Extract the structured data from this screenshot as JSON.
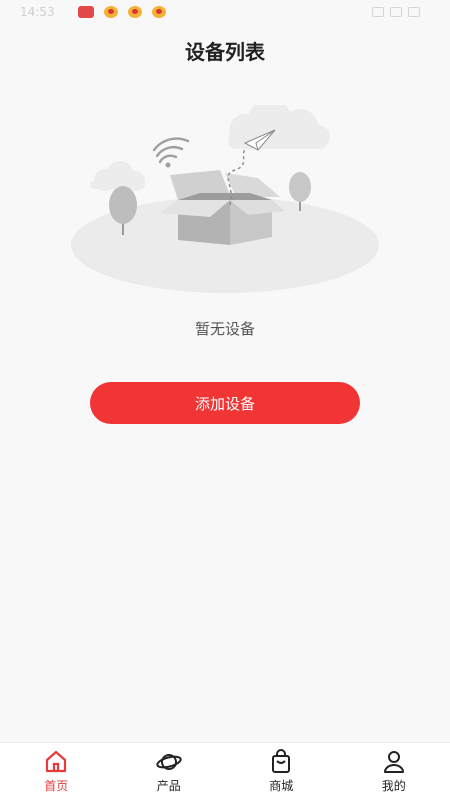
{
  "status_bar": {
    "time": "14:53"
  },
  "header": {
    "title": "设备列表"
  },
  "empty_state": {
    "message": "暂无设备"
  },
  "actions": {
    "add_device_label": "添加设备"
  },
  "tabbar": {
    "items": [
      {
        "label": "首页",
        "icon": "home-icon",
        "active": true
      },
      {
        "label": "产品",
        "icon": "planet-icon",
        "active": false
      },
      {
        "label": "商城",
        "icon": "shopping-bag-icon",
        "active": false
      },
      {
        "label": "我的",
        "icon": "user-icon",
        "active": false
      }
    ]
  },
  "colors": {
    "accent": "#f13434",
    "active_tab": "#e83a3a"
  }
}
